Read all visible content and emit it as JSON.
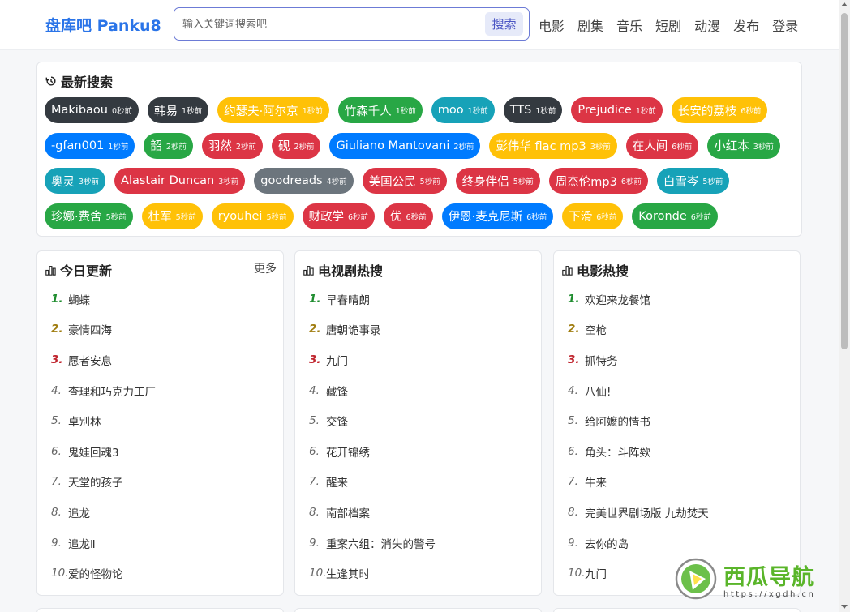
{
  "header": {
    "logo": "盘库吧  Panku8",
    "search": {
      "placeholder": "输入关键词搜索吧",
      "button": "搜索"
    },
    "nav": [
      "电影",
      "剧集",
      "音乐",
      "短剧",
      "动漫",
      "发布",
      "登录"
    ]
  },
  "recent": {
    "title": "最新搜索",
    "rows": [
      [
        {
          "name": "Makibaou",
          "time": "0秒前",
          "color": "dark"
        },
        {
          "name": "韩易",
          "time": "1秒前",
          "color": "dark"
        },
        {
          "name": "约瑟夫·阿尔京",
          "time": "1秒前",
          "color": "yellow"
        },
        {
          "name": "竹森千人",
          "time": "1秒前",
          "color": "green"
        },
        {
          "name": "moo",
          "time": "1秒前",
          "color": "teal"
        },
        {
          "name": "TTS",
          "time": "1秒前",
          "color": "dark"
        },
        {
          "name": "Prejudice",
          "time": "1秒前",
          "color": "red"
        },
        {
          "name": "长安的荔枝",
          "time": "6秒前",
          "color": "yellow"
        }
      ],
      [
        {
          "name": "-gfan001",
          "time": "1秒前",
          "color": "blue"
        },
        {
          "name": "韶",
          "time": "2秒前",
          "color": "green"
        },
        {
          "name": "羽然",
          "time": "2秒前",
          "color": "red"
        },
        {
          "name": "砚",
          "time": "2秒前",
          "color": "red"
        },
        {
          "name": "Giuliano Mantovani",
          "time": "2秒前",
          "color": "blue"
        },
        {
          "name": "彭伟华 flac mp3",
          "time": "3秒前",
          "color": "yellow"
        },
        {
          "name": "在人间",
          "time": "6秒前",
          "color": "red"
        },
        {
          "name": "小红本",
          "time": "3秒前",
          "color": "green"
        }
      ],
      [
        {
          "name": "奥灵",
          "time": "3秒前",
          "color": "teal"
        },
        {
          "name": "Alastair Duncan",
          "time": "3秒前",
          "color": "red"
        },
        {
          "name": "goodreads",
          "time": "4秒前",
          "color": "gray"
        },
        {
          "name": "美国公民",
          "time": "5秒前",
          "color": "red"
        },
        {
          "name": "终身伴侣",
          "time": "5秒前",
          "color": "red"
        },
        {
          "name": "周杰伦mp3",
          "time": "6秒前",
          "color": "red"
        },
        {
          "name": "白雪岑",
          "time": "5秒前",
          "color": "teal"
        }
      ],
      [
        {
          "name": "珍娜·费舍",
          "time": "5秒前",
          "color": "green"
        },
        {
          "name": "杜军",
          "time": "5秒前",
          "color": "yellow"
        },
        {
          "name": "ryouhei",
          "time": "5秒前",
          "color": "yellow"
        },
        {
          "name": "财政学",
          "time": "6秒前",
          "color": "red"
        },
        {
          "name": "优",
          "time": "6秒前",
          "color": "red"
        },
        {
          "name": "伊恩·麦克尼斯",
          "time": "6秒前",
          "color": "blue"
        },
        {
          "name": "下滑",
          "time": "6秒前",
          "color": "yellow"
        },
        {
          "name": "Koronde",
          "time": "6秒前",
          "color": "green"
        }
      ]
    ]
  },
  "today": {
    "title": "今日更新",
    "more": "更多",
    "items": [
      "蝴蝶",
      "豪情四海",
      "愿者安息",
      "查理和巧克力工厂",
      "卓别林",
      "鬼娃回魂3",
      "天堂的孩子",
      "追龙",
      "追龙Ⅱ",
      "爱的怪物论"
    ]
  },
  "tv": {
    "title": "电视剧热搜",
    "items": [
      "早春晴朗",
      "唐朝诡事录",
      "九门",
      "藏锋",
      "交锋",
      "花开锦绣",
      "醒来",
      "南部档案",
      "重案六组：消失的警号",
      "生逢其时"
    ]
  },
  "movie": {
    "title": "电影热搜",
    "items": [
      "欢迎来龙餐馆",
      "空枪",
      "抓特务",
      "八仙!",
      "给阿嬷的情书",
      "角头：斗阵欸",
      "牛来",
      "完美世界剧场版 九劫焚天",
      "去你的岛",
      "九门"
    ]
  },
  "ranks": [
    "1.",
    "2.",
    "3.",
    "4.",
    "5.",
    "6.",
    "7.",
    "8.",
    "9.",
    "10."
  ],
  "watermark": {
    "text": "西瓜导航",
    "url": "https://xgdh.cn"
  },
  "colors": {
    "dark": "#343a40",
    "yellow": "#ffc107",
    "green": "#28a745",
    "teal": "#17a2b8",
    "red": "#dc3545",
    "blue": "#007bff",
    "gray": "#6c757d",
    "brand": "#2a74e8"
  },
  "icons": {
    "recent": "history-icon",
    "list": "bar-chart-icon"
  }
}
